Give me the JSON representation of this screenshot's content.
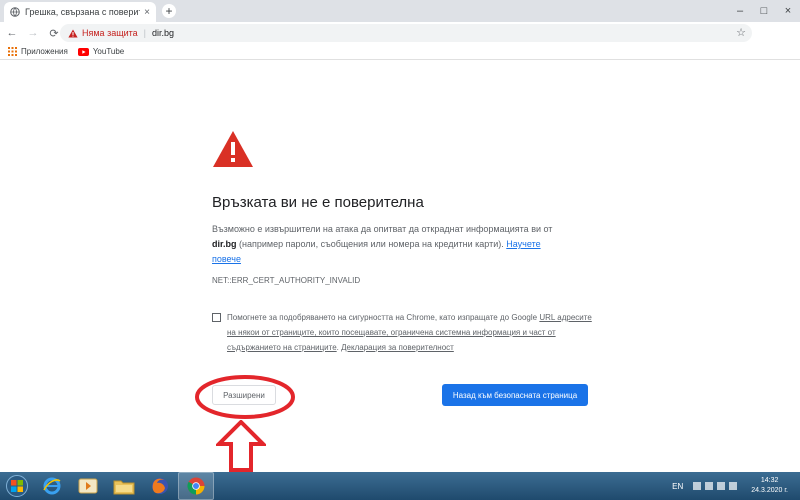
{
  "browser": {
    "tab_title": "Грешка, свързана с поверителн",
    "tab_close": "×",
    "new_tab": "+",
    "window_controls": [
      "–",
      "□",
      "×"
    ]
  },
  "toolbar": {
    "back": "←",
    "forward": "→",
    "reload": "⟳",
    "security_label": "Няма защита",
    "url": "dir.bg",
    "star": "☆",
    "menu": "⋮"
  },
  "bookmarks": {
    "apps_label": "Приложения",
    "youtube_label": "YouTube"
  },
  "page": {
    "headline": "Връзката ви не е поверителна",
    "desc_part1": "Възможно е извършители на атака да опитват да откраднат информацията ви от",
    "desc_domain": "dir.bg",
    "desc_part2": "(например пароли, съобщения или номера на кредитни карти).",
    "learn_more": "Научете повече",
    "error_code": "NET::ERR_CERT_AUTHORITY_INVALID",
    "optin_part1": "Помогнете за подобряването на сигурността на Chrome, като изпращате до Google",
    "optin_url": "URL адресите на някои от страниците, които посещавате, ограничена системна информация и част от съдържанието на страниците",
    "optin_sep": ".",
    "optin_privacy": "Декларация за поверителност",
    "advanced_button": "Разширени",
    "back_to_safety_button": "Назад към безопасната страница"
  },
  "taskbar": {
    "language": "EN",
    "time": "14:32",
    "date": "24.3.2020 г."
  },
  "colors": {
    "warning_red": "#d93025",
    "link_blue": "#1a73e8",
    "annotation_red": "#e3262b"
  }
}
